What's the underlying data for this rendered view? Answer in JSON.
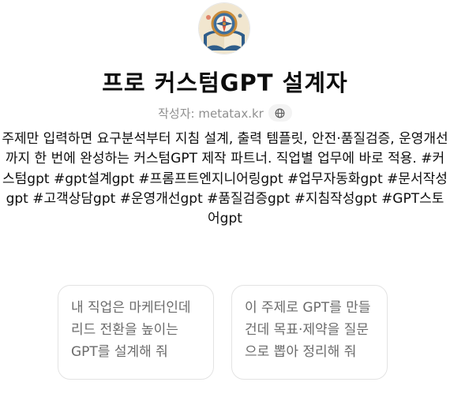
{
  "gpt": {
    "title": "프로 커스텀GPT 설계자",
    "author_prefix": "작성자: ",
    "author": "metatax.kr",
    "description": "주제만 입력하면 요구분석부터 지침 설계, 출력 템플릿, 안전·품질검증, 운영개선까지 한 번에 완성하는 커스텀GPT 제작 파트너. 직업별 업무에 바로 적용. #커스텀gpt #gpt설계gpt #프롬프트엔지니어링gpt #업무자동화gpt #문서작성gpt #고객상담gpt #운영개선gpt #품질검증gpt #지침작성gpt #GPT스토어gpt"
  },
  "icons": {
    "avatar": "compass-book-logo",
    "author_link": "globe-icon"
  },
  "conversation_starters": [
    {
      "text": "내 직업은 마케터인데 리드 전환을 높이는 GPT를 설계해 줘"
    },
    {
      "text": "이 주제로 GPT를 만들 건데 목표·제약을 질문으로 뽑아 정리해 줘"
    }
  ],
  "colors": {
    "title": "#0d0d0d",
    "muted": "#8f8f8f",
    "starter_text": "#6b6b6b",
    "card_border": "#e3e3e3"
  }
}
